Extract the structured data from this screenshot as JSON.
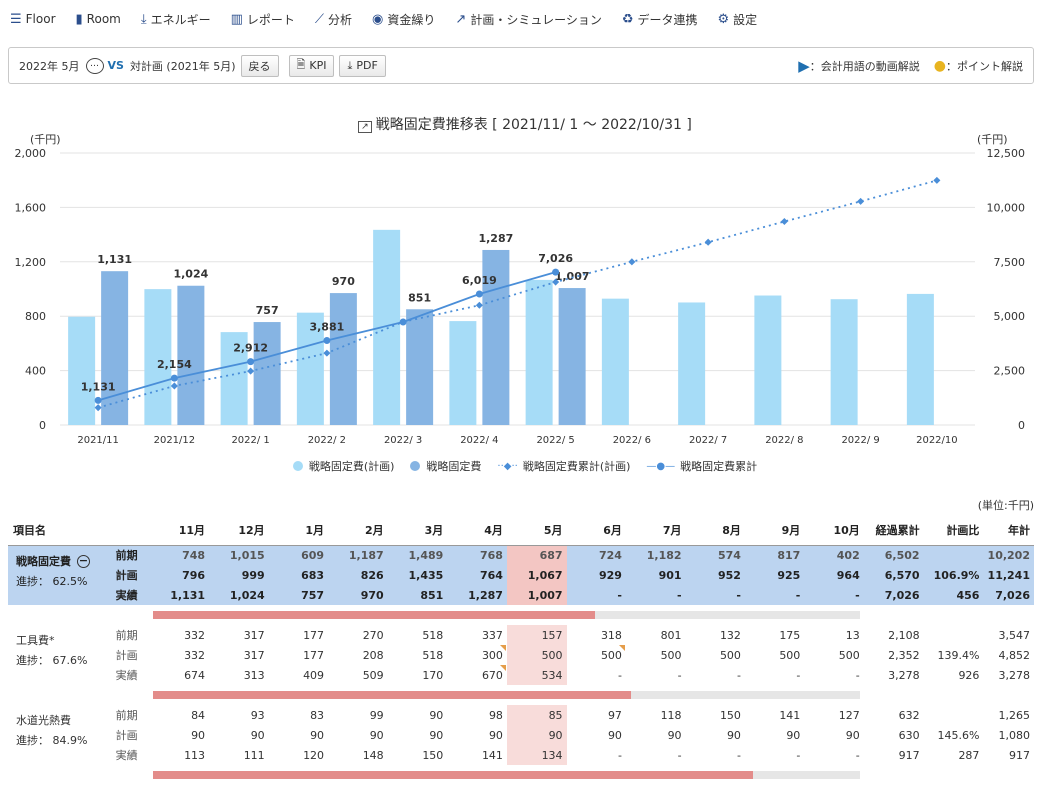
{
  "nav": [
    {
      "icon": "layers-icon",
      "glyph": "☰",
      "label": "Floor"
    },
    {
      "icon": "room-icon",
      "glyph": "▮",
      "label": "Room"
    },
    {
      "icon": "download-icon",
      "glyph": "⤓",
      "label": "エネルギー"
    },
    {
      "icon": "bar-chart-icon",
      "glyph": "▥",
      "label": "レポート"
    },
    {
      "icon": "line-chart-icon",
      "glyph": "⟋",
      "label": "分析"
    },
    {
      "icon": "funds-icon",
      "glyph": "◉",
      "label": "資金繰り"
    },
    {
      "icon": "plan-icon",
      "glyph": "↗",
      "label": "計画・シミュレーション"
    },
    {
      "icon": "sync-icon",
      "glyph": "♻",
      "label": "データ連携"
    },
    {
      "icon": "gear-icon",
      "glyph": "⚙",
      "label": "設定"
    }
  ],
  "toolbar": {
    "period": "2022年 5月",
    "vs": "VS",
    "compare": "対計画 (2021年 5月)",
    "back": "戻る",
    "kpi": "KPI",
    "pdf": "PDF",
    "video_help": "：会計用語の動画解説",
    "point_help": "：ポイント解説"
  },
  "chart_data": {
    "type": "bar",
    "title": "戦略固定費推移表 [ 2021/11/ 1 ～ 2022/10/31 ]",
    "ylabel_left": "(千円)",
    "ylabel_right": "(千円)",
    "ylim_left": [
      0,
      2000
    ],
    "yticks_left": [
      "2,000",
      "1,600",
      "1,200",
      "800",
      "400",
      "0"
    ],
    "ylim_right": [
      0,
      12500
    ],
    "yticks_right": [
      "12,500",
      "10,000",
      "7,500",
      "5,000",
      "2,500",
      "0"
    ],
    "categories": [
      "2021/11",
      "2021/12",
      "2022/ 1",
      "2022/ 2",
      "2022/ 3",
      "2022/ 4",
      "2022/ 5",
      "2022/ 6",
      "2022/ 7",
      "2022/ 8",
      "2022/ 9",
      "2022/10"
    ],
    "series": [
      {
        "name": "戦略固定費(計画)",
        "kind": "bar",
        "axis": "left",
        "color": "#a6dcf7",
        "values": [
          796,
          999,
          683,
          826,
          1435,
          764,
          1067,
          929,
          901,
          952,
          925,
          964
        ]
      },
      {
        "name": "戦略固定費",
        "kind": "bar",
        "axis": "left",
        "color": "#86b4e3",
        "values": [
          1131,
          1024,
          757,
          970,
          851,
          1287,
          1007
        ],
        "labels": [
          "1,131",
          "1,024",
          "757",
          "970",
          "851",
          "1,287",
          "1,007"
        ]
      },
      {
        "name": "戦略固定費累計(計画)",
        "kind": "dotted-line",
        "axis": "right",
        "color": "#4a8ed8",
        "values": [
          796,
          1795,
          2478,
          3304,
          4739,
          5503,
          6570,
          7499,
          8400,
          9352,
          10277,
          11241
        ]
      },
      {
        "name": "戦略固定費累計",
        "kind": "line",
        "axis": "right",
        "color": "#4a8ed8",
        "values": [
          1131,
          2155,
          2912,
          3882,
          4733,
          6020,
          7027
        ],
        "labels": [
          "1,131",
          "2,154",
          "2,912",
          "3,881",
          "",
          "6,019",
          "7,026"
        ]
      }
    ],
    "legend_position": "bottom",
    "grid": "horizontal"
  },
  "table": {
    "unit": "(単位:千円)",
    "headers": [
      "項目名",
      "",
      "",
      "11月",
      "12月",
      "1月",
      "2月",
      "3月",
      "4月",
      "5月",
      "6月",
      "7月",
      "8月",
      "9月",
      "10月",
      "経過累計",
      "計画比",
      "年計"
    ],
    "row_labels": [
      "前期",
      "計画",
      "実績"
    ],
    "groups": [
      {
        "name": "戦略固定費",
        "progress_label": "進捗： 62.5%",
        "progress": 0.625,
        "highlight": true,
        "rows": [
          [
            "748",
            "1,015",
            "609",
            "1,187",
            "1,489",
            "768",
            "687",
            "724",
            "1,182",
            "574",
            "817",
            "402",
            "6,502",
            "",
            "10,202"
          ],
          [
            "796",
            "999",
            "683",
            "826",
            "1,435",
            "764",
            "1,067",
            "929",
            "901",
            "952",
            "925",
            "964",
            "6,570",
            "106.9%",
            "11,241"
          ],
          [
            "1,131",
            "1,024",
            "757",
            "970",
            "851",
            "1,287",
            "1,007",
            "-",
            "-",
            "-",
            "-",
            "-",
            "7,026",
            "456",
            "7,026"
          ]
        ]
      },
      {
        "name": "工具費*",
        "progress_label": "進捗： 67.6%",
        "progress": 0.676,
        "highlight": false,
        "rows": [
          [
            "332",
            "317",
            "177",
            "270",
            "518",
            "337",
            "157",
            "318",
            "801",
            "132",
            "175",
            "13",
            "2,108",
            "",
            "3,547"
          ],
          [
            "332",
            "317",
            "177",
            "208",
            "518",
            "300",
            "500",
            "500",
            "500",
            "500",
            "500",
            "500",
            "2,352",
            "139.4%",
            "4,852"
          ],
          [
            "674",
            "313",
            "409",
            "509",
            "170",
            "670",
            "534",
            "-",
            "-",
            "-",
            "-",
            "-",
            "3,278",
            "926",
            "3,278"
          ]
        ]
      },
      {
        "name": "水道光熱費",
        "progress_label": "進捗： 84.9%",
        "progress": 0.849,
        "highlight": false,
        "rows": [
          [
            "84",
            "93",
            "83",
            "99",
            "90",
            "98",
            "85",
            "97",
            "118",
            "150",
            "141",
            "127",
            "632",
            "",
            "1,265"
          ],
          [
            "90",
            "90",
            "90",
            "90",
            "90",
            "90",
            "90",
            "90",
            "90",
            "90",
            "90",
            "90",
            "630",
            "145.6%",
            "1,080"
          ],
          [
            "113",
            "111",
            "120",
            "148",
            "150",
            "141",
            "134",
            "-",
            "-",
            "-",
            "-",
            "-",
            "917",
            "287",
            "917"
          ]
        ]
      }
    ]
  }
}
